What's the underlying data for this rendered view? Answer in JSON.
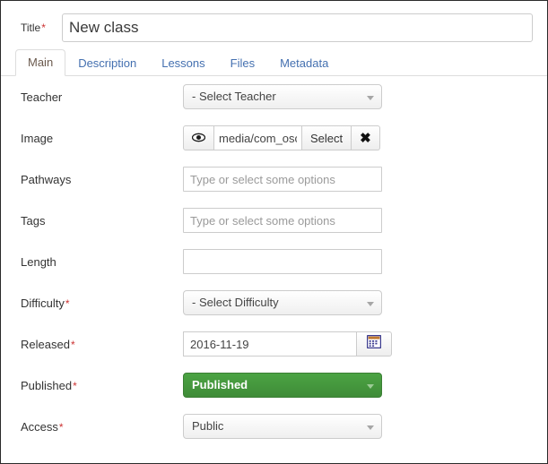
{
  "title_field": {
    "label": "Title",
    "required_mark": "*",
    "value": "New class"
  },
  "tabs": [
    {
      "label": "Main",
      "active": true
    },
    {
      "label": "Description",
      "active": false
    },
    {
      "label": "Lessons",
      "active": false
    },
    {
      "label": "Files",
      "active": false
    },
    {
      "label": "Metadata",
      "active": false
    }
  ],
  "fields": {
    "teacher": {
      "label": "Teacher",
      "required_mark": "",
      "selected": "- Select Teacher"
    },
    "image": {
      "label": "Image",
      "required_mark": "",
      "preview_icon": "eye-icon",
      "value": "media/com_osc",
      "select_label": "Select",
      "clear_icon": "✖"
    },
    "pathways": {
      "label": "Pathways",
      "required_mark": "",
      "value": "",
      "placeholder": "Type or select some options"
    },
    "tags": {
      "label": "Tags",
      "required_mark": "",
      "value": "",
      "placeholder": "Type or select some options"
    },
    "length": {
      "label": "Length",
      "required_mark": "",
      "value": "",
      "placeholder": ""
    },
    "difficulty": {
      "label": "Difficulty",
      "required_mark": "*",
      "selected": "- Select Difficulty"
    },
    "released": {
      "label": "Released",
      "required_mark": "*",
      "value": "2016-11-19",
      "calendar_icon": "calendar-icon"
    },
    "published": {
      "label": "Published",
      "required_mark": "*",
      "selected": "Published"
    },
    "access": {
      "label": "Access",
      "required_mark": "*",
      "selected": "Public"
    }
  },
  "colors": {
    "published_green": "#4ba343",
    "tab_link": "#4470b0",
    "required_red": "#cc3333",
    "label_text": "#333333"
  }
}
